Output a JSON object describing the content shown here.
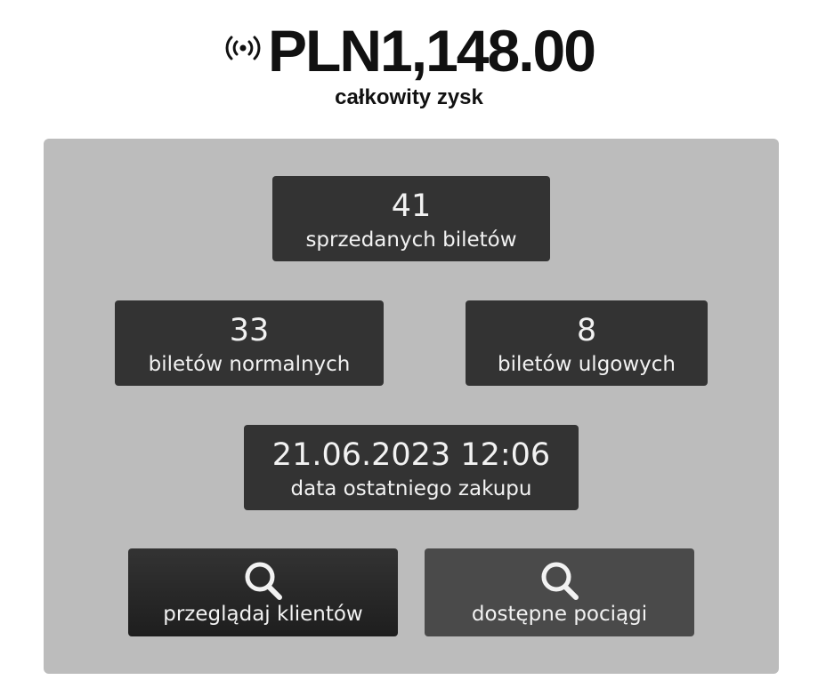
{
  "header": {
    "total_amount": "PLN1,148.00",
    "total_label": "całkowity zysk",
    "live_icon": "broadcast-icon"
  },
  "stats": {
    "sold": {
      "value": "41",
      "label": "sprzedanych biletów"
    },
    "normal": {
      "value": "33",
      "label": "biletów normalnych"
    },
    "reduced": {
      "value": "8",
      "label": "biletów ulgowych"
    },
    "last_purchase": {
      "value": "21.06.2023 12:06",
      "label": "data ostatniego zakupu"
    }
  },
  "actions": {
    "browse_clients": {
      "label": "przeglądaj klientów",
      "icon": "search-icon"
    },
    "available_trains": {
      "label": "dostępne pociągi",
      "icon": "search-icon"
    }
  },
  "colors": {
    "panel": "#bcbcbc",
    "card": "#333333",
    "button_dark": "#262626",
    "button_grey": "#4a4a4a",
    "text_light": "#f2f2f2",
    "text_dark": "#111111"
  }
}
